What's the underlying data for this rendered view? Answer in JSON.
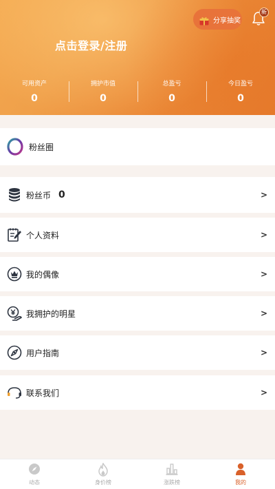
{
  "header": {
    "share_label": "分享抽奖",
    "new_badge": "新",
    "login_text": "点击登录/注册"
  },
  "stats": [
    {
      "label": "可用资产",
      "value": "0"
    },
    {
      "label": "拥护市值",
      "value": "0"
    },
    {
      "label": "总盈亏",
      "value": "0"
    },
    {
      "label": "今日盈亏",
      "value": "0"
    }
  ],
  "menu": {
    "fans_circle": "粉丝圈",
    "fans_coin": "粉丝币",
    "fans_coin_value": "0",
    "profile": "个人资料",
    "my_idol": "我的偶像",
    "my_star": "我拥护的明星",
    "user_guide": "用户指南",
    "contact": "联系我们",
    "arrow": ">"
  },
  "tabs": [
    {
      "label": "动态",
      "icon": "compass-icon"
    },
    {
      "label": "身价榜",
      "icon": "flame-icon"
    },
    {
      "label": "涨跌榜",
      "icon": "bar-chart-icon"
    },
    {
      "label": "我的",
      "icon": "person-icon"
    }
  ],
  "colors": {
    "accent": "#e57a2c",
    "active_tab": "#d9612a",
    "background": "#f8f2ee"
  }
}
